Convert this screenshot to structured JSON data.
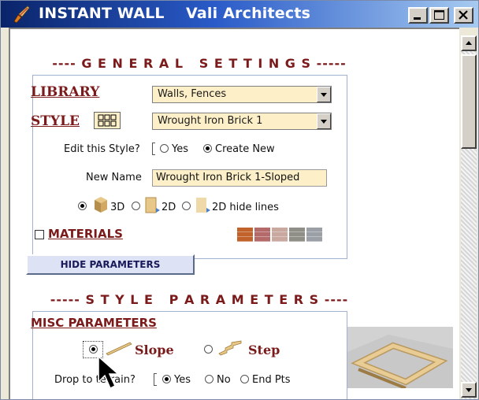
{
  "window": {
    "app_name": "INSTANT WALL",
    "company": "Vali Architects",
    "title_gap": "    "
  },
  "general": {
    "header": "---- G E N E R A L   S E T T I N G S -----",
    "library_label": "LIBRARY",
    "library_value": "Walls, Fences",
    "style_label": "STYLE",
    "style_value": "Wrought Iron Brick 1",
    "edit_style_label": "Edit this Style?",
    "yes_label": "Yes",
    "create_new_label": "Create New",
    "edit_style_selected": "Create New",
    "new_name_label": "New Name",
    "new_name_value": "Wrought Iron Brick 1-Sloped",
    "view_3d": "3D",
    "view_2d": "2D",
    "view_2d_hide": "2D hide lines",
    "view_selected": "3D",
    "materials_label": "MATERIALS",
    "materials_checked": false,
    "material_swatches": [
      "#c0622a",
      "#b56a6a",
      "#c9a8a0",
      "#8f8f88",
      "#9aa0a6"
    ]
  },
  "hide_params_label": "HIDE PARAMETERS",
  "style_params": {
    "header": "----- S T Y L E   P A R A M E T E R S ----",
    "misc_label": "MISC PARAMETERS",
    "slope_label": "Slope",
    "step_label": "Step",
    "mode_selected": "Slope",
    "drop_label": "Drop to terrain?",
    "drop_yes": "Yes",
    "drop_no": "No",
    "drop_endpts": "End Pts",
    "drop_selected": "Yes"
  },
  "colors": {
    "accent_red": "#7b1a1a",
    "field_yellow": "#fdf0c8",
    "title_blue": "#0a246a"
  }
}
